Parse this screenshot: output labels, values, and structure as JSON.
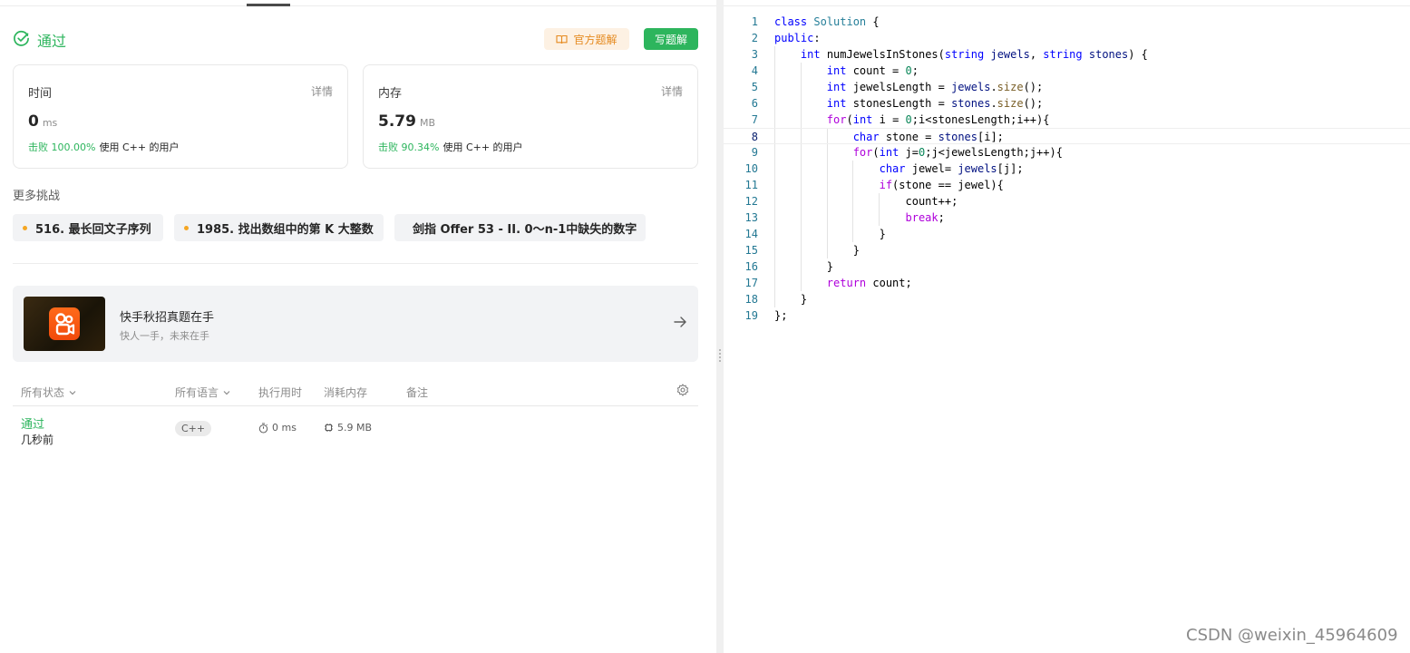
{
  "result": {
    "status": "通过",
    "official_solution_label": "官方题解",
    "write_solution_label": "写题解"
  },
  "cards": {
    "time": {
      "title": "时间",
      "detail": "详情",
      "value": "0",
      "unit": "ms",
      "beat": "击败 100.00%",
      "suffix": "使用 C++ 的用户"
    },
    "memory": {
      "title": "内存",
      "detail": "详情",
      "value": "5.79",
      "unit": "MB",
      "beat": "击败 90.34%",
      "suffix": "使用 C++ 的用户"
    }
  },
  "more": {
    "title": "更多挑战",
    "items": [
      {
        "label": "516. 最长回文子序列",
        "dot_color": "#f5a623"
      },
      {
        "label": "1985. 找出数组中的第 K 大整数",
        "dot_color": "#f5a623"
      },
      {
        "label": "剑指 Offer 53 - II. 0～n-1中缺失的数字",
        "dot_color": "#00af9b"
      }
    ]
  },
  "banner": {
    "title": "快手秋招真题在手",
    "subtitle": "快人一手，未来在手"
  },
  "submissions": {
    "headers": {
      "status": "所有状态",
      "language": "所有语言",
      "runtime": "执行用时",
      "memory": "消耗内存",
      "note": "备注"
    },
    "rows": [
      {
        "status": "通过",
        "when": "几秒前",
        "language": "C++",
        "runtime": "0 ms",
        "memory": "5.9 MB"
      }
    ]
  },
  "editor": {
    "active_line": 8,
    "lines": [
      "class Solution {",
      "public:",
      "    int numJewelsInStones(string jewels, string stones) {",
      "        int count = 0;",
      "        int jewelsLength = jewels.size();",
      "        int stonesLength = stones.size();",
      "        for(int i = 0;i<stonesLength;i++){",
      "            char stone = stones[i];",
      "            for(int j=0;j<jewelsLength;j++){",
      "                char jewel= jewels[j];",
      "                if(stone == jewel){",
      "                    count++;",
      "                    break;",
      "                }",
      "            }",
      "        }",
      "        return count;",
      "    }",
      "};"
    ]
  },
  "watermark": "CSDN @weixin_45964609",
  "colors": {
    "accent": "#2db55d",
    "official": "#e58a1f"
  }
}
